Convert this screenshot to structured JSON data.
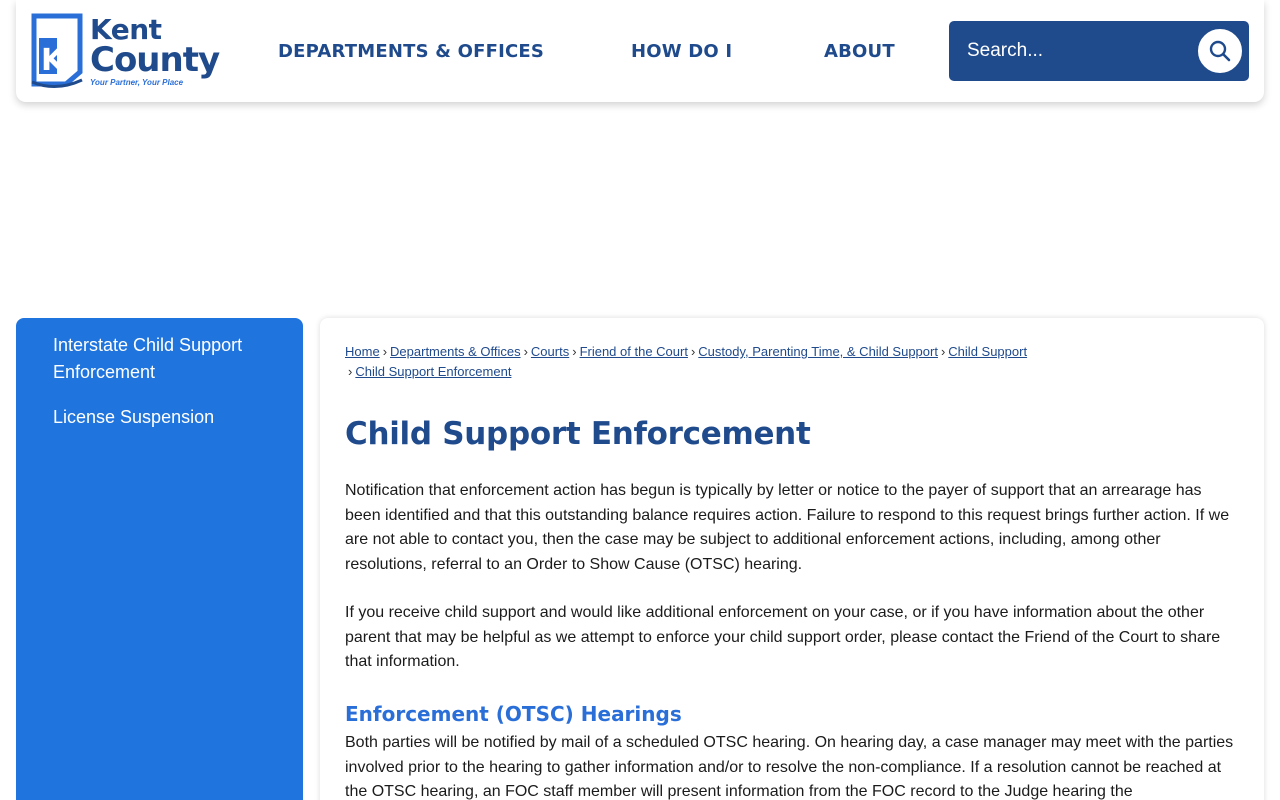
{
  "logo": {
    "line1": "Kent",
    "line2": "County",
    "tagline": "Your Partner, Your Place",
    "mark_letter": "K"
  },
  "nav": {
    "departments": "DEPARTMENTS & OFFICES",
    "how_do_i": "HOW DO I",
    "about": "ABOUT"
  },
  "search": {
    "placeholder": "Search...",
    "icon": "search-icon"
  },
  "sidebar": {
    "items": [
      {
        "label": "Interstate Child Support Enforcement"
      },
      {
        "label": "License Suspension"
      }
    ]
  },
  "breadcrumb": {
    "items": [
      {
        "label": "Home"
      },
      {
        "label": "Departments & Offices"
      },
      {
        "label": "Courts"
      },
      {
        "label": "Friend of the Court"
      },
      {
        "label": "Custody, Parenting Time, & Child Support"
      },
      {
        "label": "Child Support"
      },
      {
        "label": "Child Support Enforcement"
      }
    ],
    "separator": "›"
  },
  "content": {
    "title": "Child Support Enforcement",
    "paragraph1": "Notification that enforcement action has begun is typically by letter or notice to the payer of support that an arrearage has been identified and that this outstanding balance requires action. Failure to respond to this request brings further action. If we are not able to contact you, then the case may be subject to additional enforcement actions, including, among other resolutions, referral to an Order to Show Cause (OTSC) hearing.",
    "paragraph2": "If you receive child support and would like additional enforcement on your case, or if you have information about the other parent that may be helpful as we attempt to enforce your child support order, please contact the Friend of the Court to share that information.",
    "subheading": "Enforcement (OTSC) Hearings",
    "paragraph3": "Both parties will be notified by mail of a scheduled OTSC hearing. On hearing day, a case manager may meet with the parties involved prior to the hearing to gather information and/or to resolve the non-compliance. If a resolution cannot be reached at the OTSC hearing, an FOC staff member will present information from the FOC record to the Judge hearing the"
  },
  "colors": {
    "brand_navy": "#1f4a8c",
    "sidebar_blue": "#1f74de",
    "subhead_blue": "#2a6fd8"
  }
}
